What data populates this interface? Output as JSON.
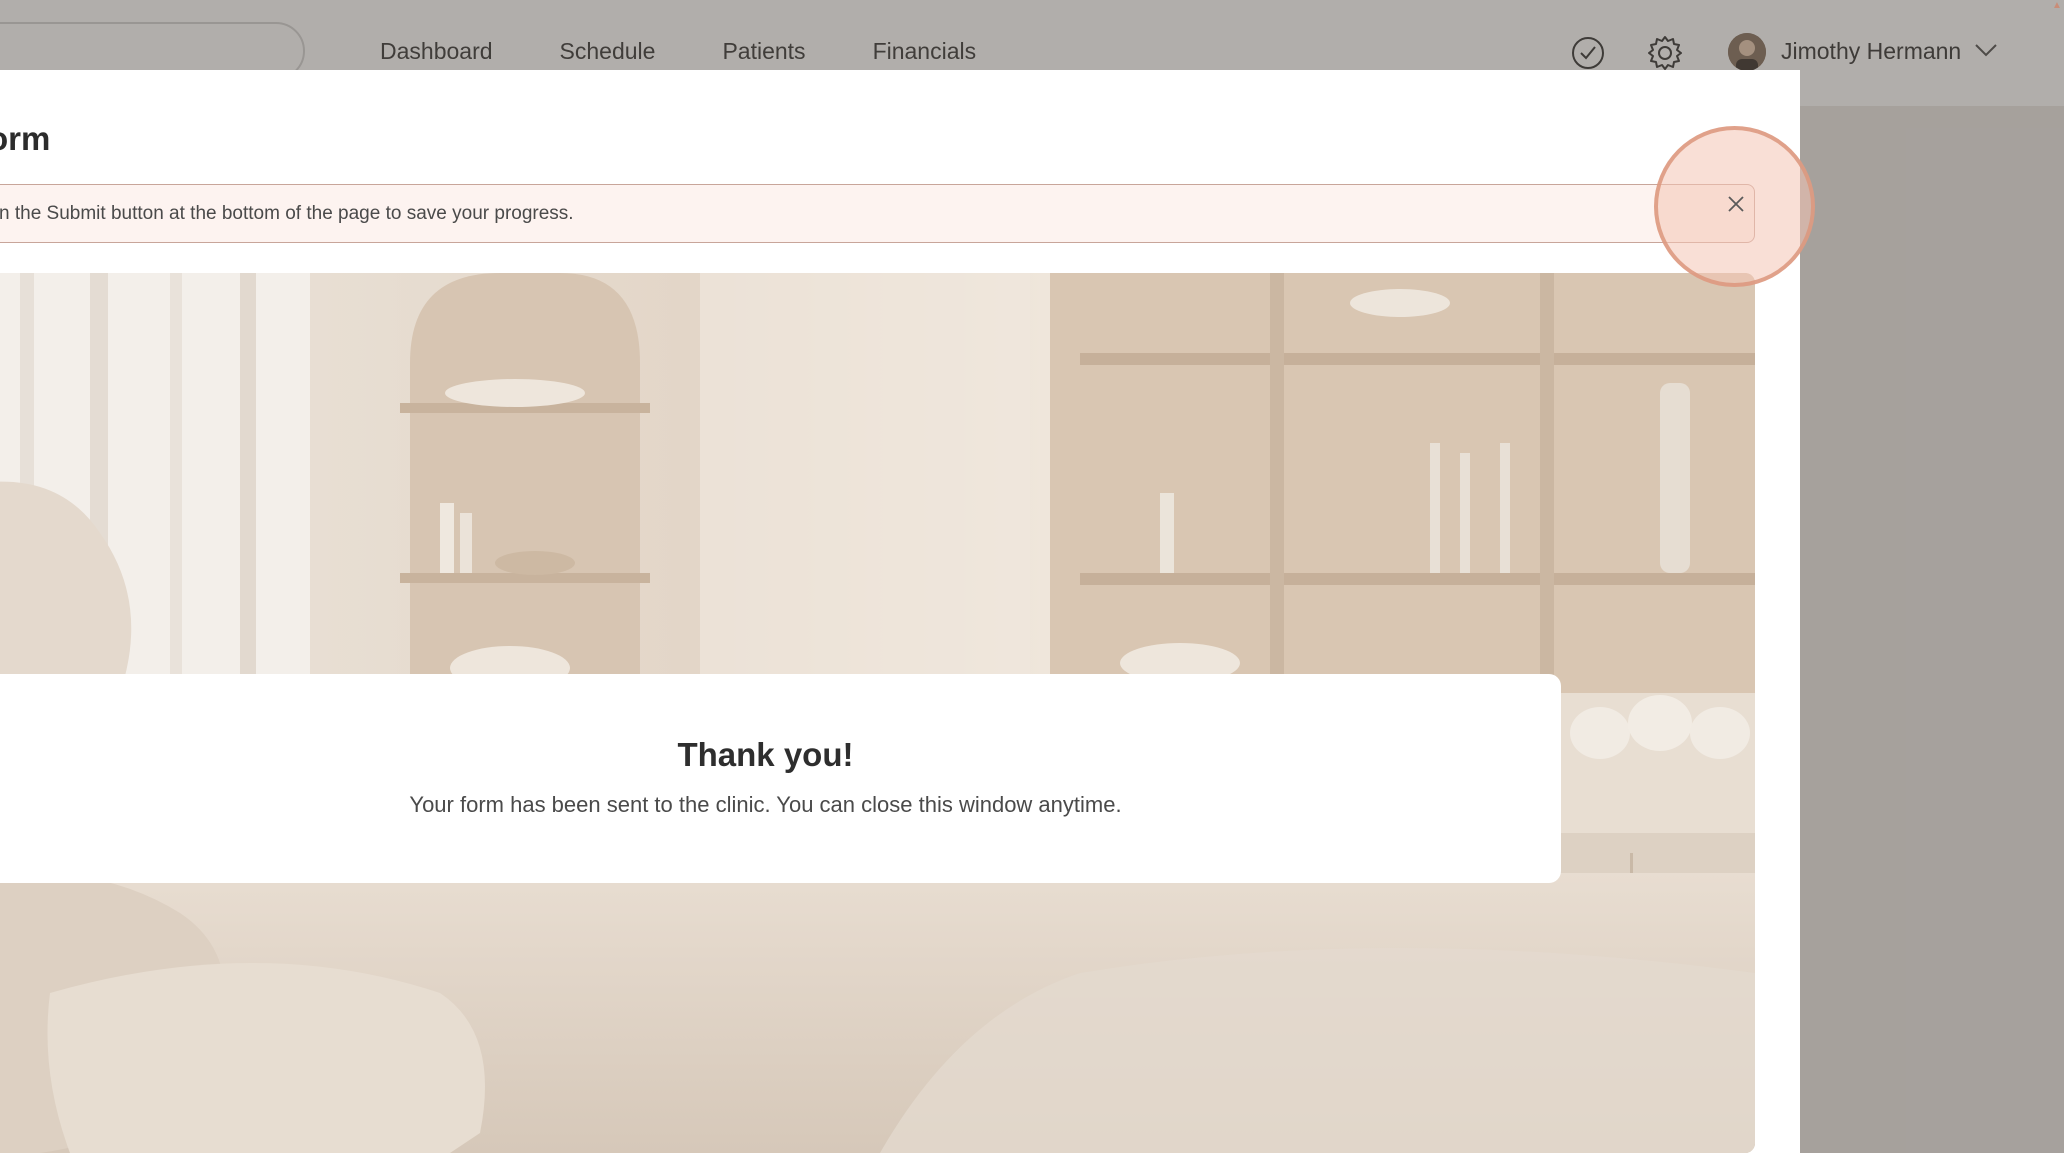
{
  "nav": {
    "items": [
      "Dashboard",
      "Schedule",
      "Patients",
      "Financials"
    ]
  },
  "user": {
    "name": "Jimothy Hermann"
  },
  "icons": {
    "tasks": "check-circle-icon",
    "settings": "gear-icon",
    "user_menu": "chevron-down-icon",
    "close": "close-icon"
  },
  "modal": {
    "title": "orm",
    "notice": "n the Submit button at the bottom of the page to save your progress.",
    "thanks_title": "Thank you!",
    "thanks_message": "Your form has been sent to the clinic. You can close this window anytime."
  },
  "colors": {
    "accent_ring": "#f4c4b4",
    "notice_border": "#c8a59a",
    "notice_bg": "#fdf3f0"
  }
}
